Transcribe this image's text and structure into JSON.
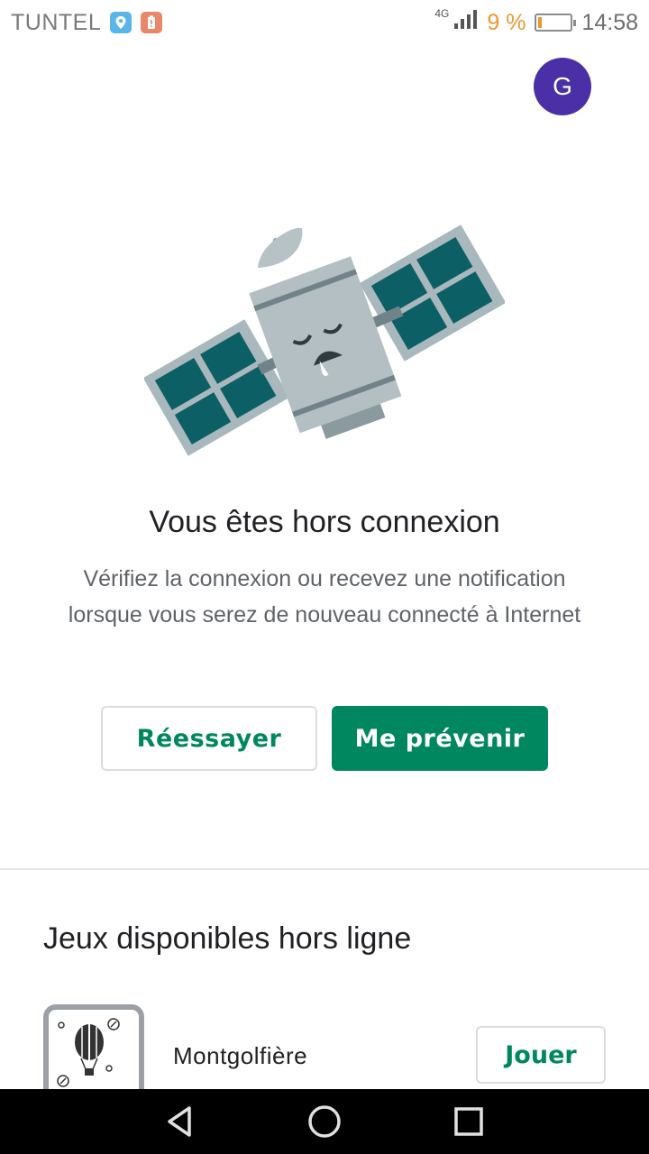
{
  "status_bar": {
    "carrier": "TUNTEL",
    "network_type": "4G",
    "battery_percent": "9 %",
    "time": "14:58",
    "icons": [
      "location-icon",
      "battery-alert-icon",
      "signal-icon",
      "battery-icon"
    ]
  },
  "account": {
    "avatar_initial": "G"
  },
  "offline": {
    "title": "Vous êtes hors connexion",
    "description": "Vérifiez la connexion ou recevez une notification lorsque vous serez de nouveau connecté à Internet",
    "retry_label": "Réessayer",
    "notify_label": "Me prévenir"
  },
  "offline_games": {
    "section_title": "Jeux disponibles hors ligne",
    "items": [
      {
        "name": "Montgolfière",
        "action_label": "Jouer"
      }
    ]
  },
  "colors": {
    "accent": "#01875f",
    "avatar": "#4a2fa6"
  },
  "nav": [
    "back-icon",
    "home-icon",
    "recents-icon"
  ]
}
